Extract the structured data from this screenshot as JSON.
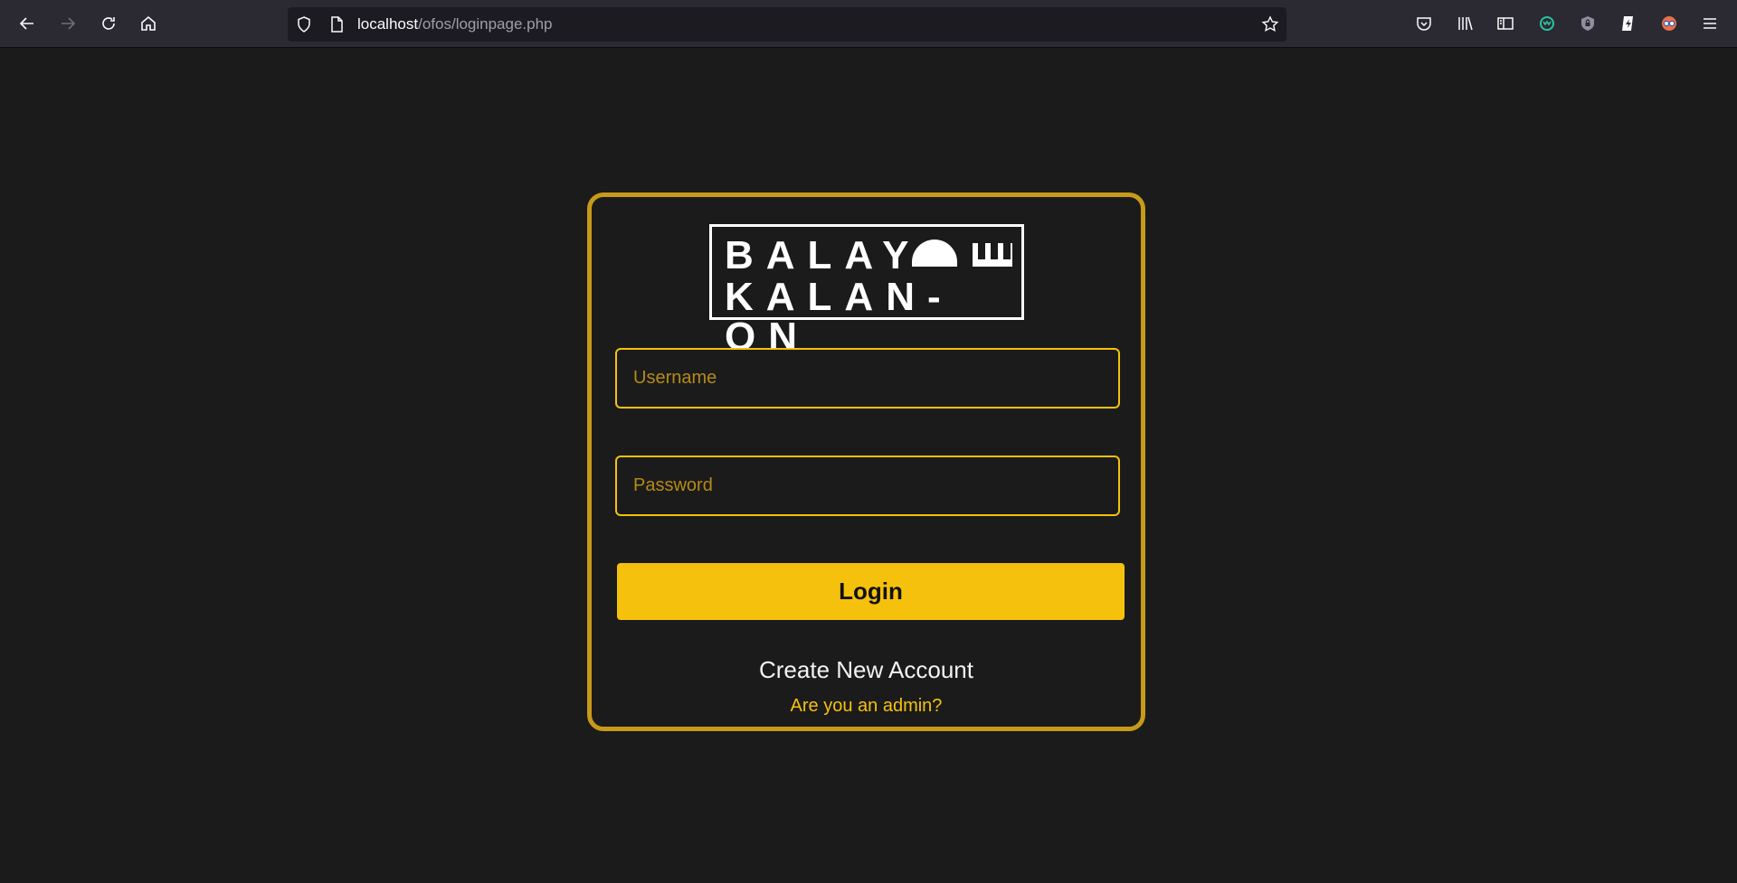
{
  "browser": {
    "url_host": "localhost",
    "url_path": "/ofos/loginpage.php",
    "icons": {
      "back": "arrow-left-icon",
      "forward": "arrow-right-icon",
      "reload": "reload-icon",
      "home": "home-icon",
      "shield": "shield-icon",
      "page": "page-icon",
      "bookmark": "star-icon",
      "pocket": "pocket-icon",
      "library": "library-icon",
      "sidebar": "sidebar-icon",
      "extension1": "extension-icon",
      "extension2": "extension-icon",
      "extension3": "extension-icon",
      "extension4": "extension-icon",
      "menu": "hamburger-menu-icon"
    }
  },
  "login": {
    "logo_line1": "BALAY",
    "logo_line2": "KALAN-ON",
    "username_placeholder": "Username",
    "password_placeholder": "Password",
    "login_label": "Login",
    "create_account_label": "Create New Account",
    "admin_label": "Are you an admin?"
  },
  "colors": {
    "background": "#1b1b1b",
    "accent": "#f6c10d",
    "card_border": "#c79a1a"
  }
}
